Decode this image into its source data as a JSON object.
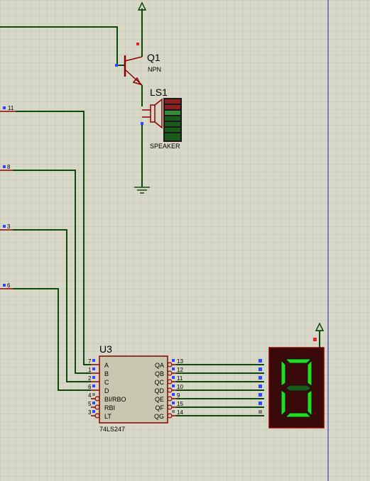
{
  "schematic": {
    "transistor": {
      "ref": "Q1",
      "value": "NPN"
    },
    "speaker": {
      "ref": "LS1",
      "value": "SPEAKER"
    },
    "decoder": {
      "ref": "U3",
      "part": "74LS247",
      "inputs": [
        {
          "pin": "7",
          "name": "A"
        },
        {
          "pin": "1",
          "name": "B"
        },
        {
          "pin": "2",
          "name": "C"
        },
        {
          "pin": "6",
          "name": "D"
        },
        {
          "pin": "4",
          "name": "BI/RBO"
        },
        {
          "pin": "5",
          "name": "RBI"
        },
        {
          "pin": "3",
          "name": "LT"
        }
      ],
      "outputs": [
        {
          "pin": "13",
          "name": "QA"
        },
        {
          "pin": "12",
          "name": "QB"
        },
        {
          "pin": "11",
          "name": "QC"
        },
        {
          "pin": "10",
          "name": "QD"
        },
        {
          "pin": "9",
          "name": "QE"
        },
        {
          "pin": "15",
          "name": "QF"
        },
        {
          "pin": "14",
          "name": "QG"
        }
      ]
    },
    "net_pins": [
      "11",
      "8",
      "3",
      "6"
    ],
    "display": {
      "digit": "0"
    }
  },
  "colors": {
    "background": "#d8d8c8",
    "grid": "#c4c4b4",
    "wire": "#0c4a0c",
    "component": "#8b0000",
    "chip_fill": "#c8c8b0",
    "display_body": "#3a0a0a",
    "segment_on": "#22dd22",
    "segment_off": "#1a5a1a",
    "pin_blue": "#3344ff",
    "pin_red": "#ee2222",
    "pin_gray": "#808080",
    "page_edge": "#2020c0"
  }
}
